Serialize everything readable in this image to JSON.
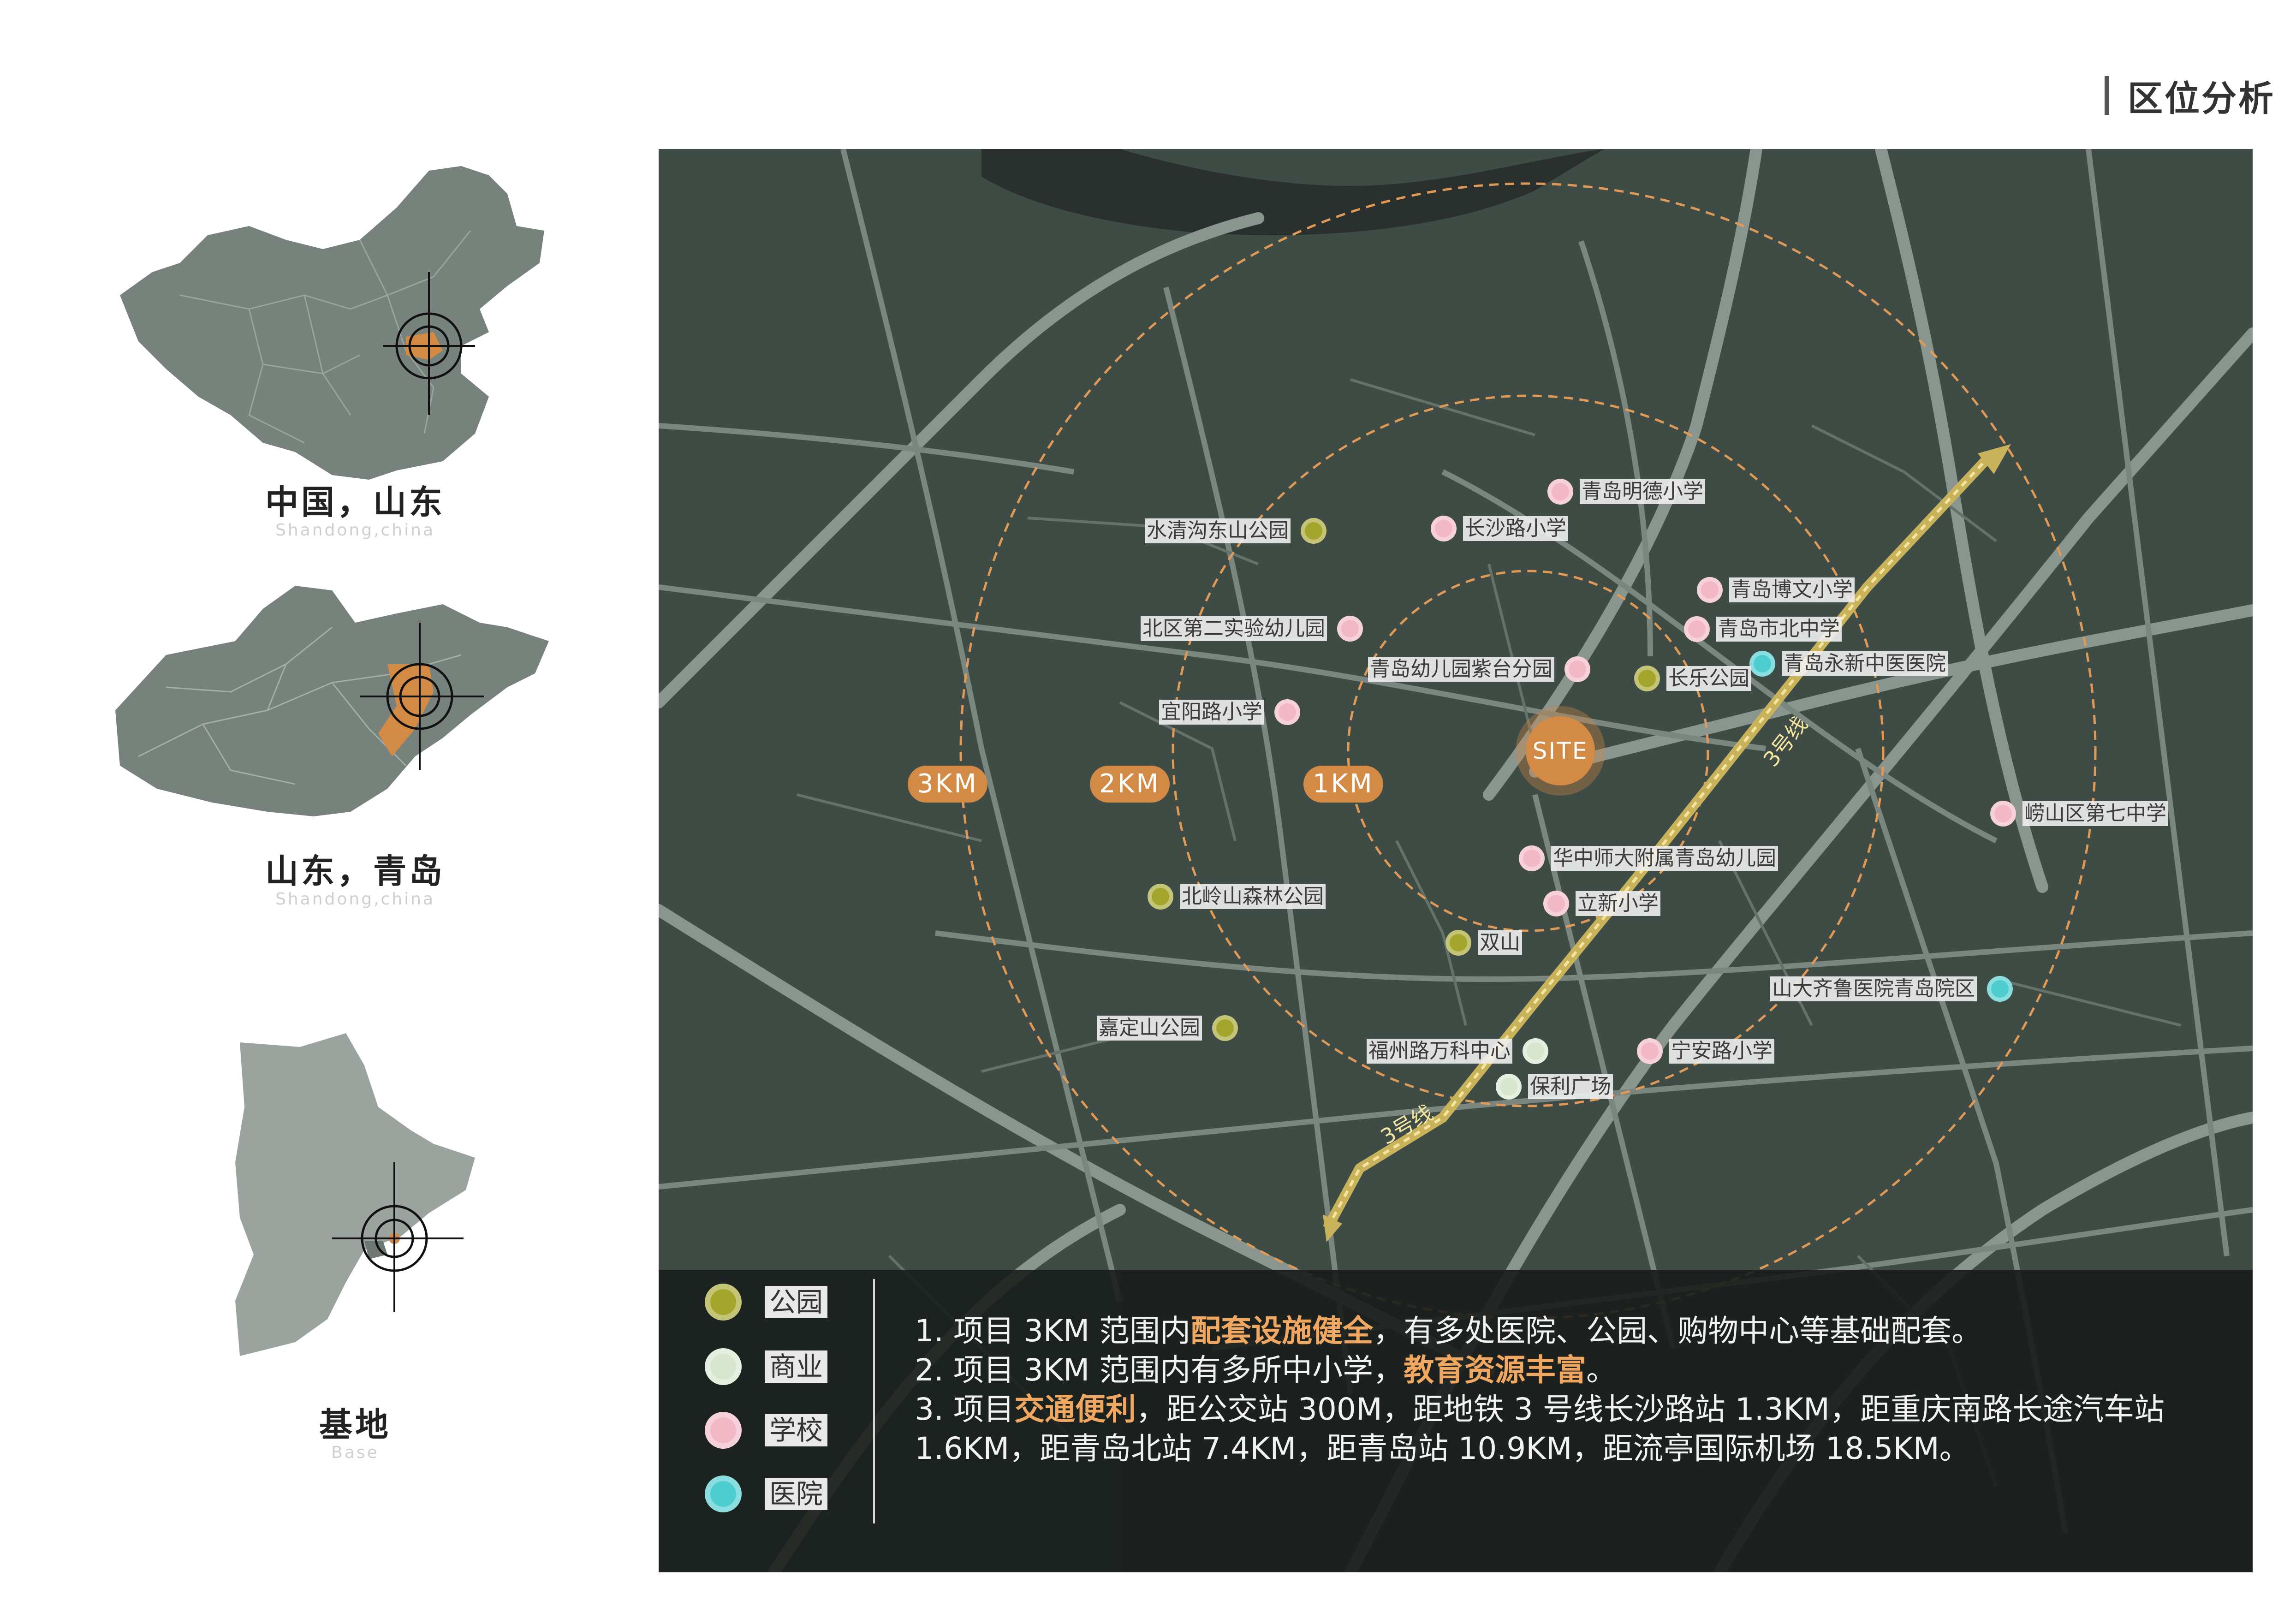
{
  "header": {
    "title": "区位分析"
  },
  "side_maps": [
    {
      "caption": "中国，山东",
      "sub": "Shandong,china"
    },
    {
      "caption": "山东，青岛",
      "sub": "Shandong,china"
    },
    {
      "caption": "基地",
      "sub": "Base"
    }
  ],
  "rings": [
    "3KM",
    "2KM",
    "1KM"
  ],
  "site_label": "SITE",
  "metro_label": "3号线",
  "pois": [
    {
      "name": "青岛明德小学",
      "category": "school"
    },
    {
      "name": "长沙路小学",
      "category": "school"
    },
    {
      "name": "水清沟东山公园",
      "category": "park"
    },
    {
      "name": "青岛博文小学",
      "category": "school"
    },
    {
      "name": "青岛市北中学",
      "category": "school"
    },
    {
      "name": "青岛永新中医医院",
      "category": "hospital"
    },
    {
      "name": "北区第二实验幼儿园",
      "category": "school"
    },
    {
      "name": "青岛幼儿园紫台分园",
      "category": "school"
    },
    {
      "name": "长乐公园",
      "category": "park"
    },
    {
      "name": "宜阳路小学",
      "category": "school"
    },
    {
      "name": "崂山区第七中学",
      "category": "school"
    },
    {
      "name": "华中师大附属青岛幼儿园",
      "category": "school"
    },
    {
      "name": "北岭山森林公园",
      "category": "park"
    },
    {
      "name": "立新小学",
      "category": "school"
    },
    {
      "name": "双山",
      "category": "park"
    },
    {
      "name": "山大齐鲁医院青岛院区",
      "category": "hospital"
    },
    {
      "name": "嘉定山公园",
      "category": "park"
    },
    {
      "name": "福州路万科中心",
      "category": "commercial"
    },
    {
      "name": "宁安路小学",
      "category": "school"
    },
    {
      "name": "保利广场",
      "category": "commercial"
    }
  ],
  "legend": [
    {
      "label": "公园",
      "color": "#a3a52d"
    },
    {
      "label": "商业",
      "color": "#d8e6cf"
    },
    {
      "label": "学校",
      "color": "#f3b8c6"
    },
    {
      "label": "医院",
      "color": "#4ecdd0"
    }
  ],
  "notes": {
    "l1_a": "1. 项目 3KM 范围内",
    "l1_b": "配套设施健全",
    "l1_c": "，有多处医院、公园、购物中心等基础配套。",
    "l2_a": "2. 项目 3KM 范围内有多所中小学，",
    "l2_b": "教育资源丰富",
    "l2_c": "。",
    "l3_a": "3. 项目",
    "l3_b": "交通便利",
    "l3_c": "，距公交站 300M，距地铁 3 号线长沙路站 1.3KM，距重庆南路长途汽车站 1.6KM，距青岛北站 7.4KM，距青岛站 10.9KM，距流亭国际机场 18.5KM。"
  },
  "colors": {
    "accent": "#d38a44",
    "map_bg": "#3f4c46",
    "road": "#8a958f",
    "highlight": "#f0a860"
  }
}
